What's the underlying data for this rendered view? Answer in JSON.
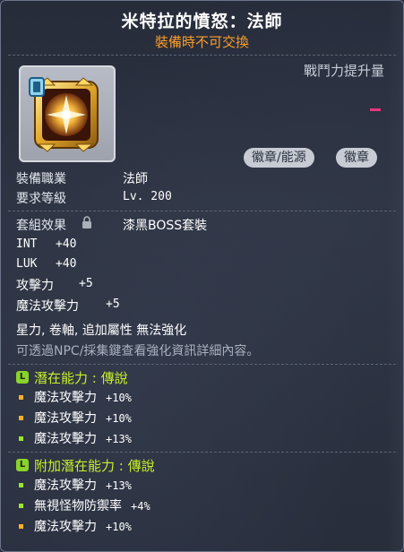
{
  "item": {
    "name": "米特拉的憤怒：法師",
    "trade_restriction": "裝備時不可交換",
    "power_label": "戰鬥力提升量",
    "power_color": "#e8357c",
    "icon": "mitra-emblem-icon"
  },
  "badges": [
    "徽章/能源",
    "徽章"
  ],
  "requirements": {
    "job_label": "裝備職業",
    "job_value": "法師",
    "level_label": "要求等級",
    "level_value": "Lv. 200"
  },
  "set": {
    "label": "套組效果",
    "value": "漆黑BOSS套裝"
  },
  "stats": [
    {
      "name": "INT",
      "value": "+40"
    },
    {
      "name": "LUK",
      "value": "+40"
    },
    {
      "name": "攻擊力",
      "value": "+5"
    },
    {
      "name": "魔法攻擊力",
      "value": "+5"
    }
  ],
  "flags": "星力, 卷軸, 追加屬性 無法強化",
  "hint": "可透過NPC/採集鍵查看強化資訊詳細內容。",
  "potential": {
    "title": "潛在能力 : 傳說",
    "grade_letter": "L",
    "lines": [
      {
        "name": "魔法攻擊力",
        "value": "+10%"
      },
      {
        "name": "魔法攻擊力",
        "value": "+10%"
      },
      {
        "name": "魔法攻擊力",
        "value": "+13%"
      }
    ]
  },
  "additional_potential": {
    "title": "附加潛在能力 : 傳說",
    "grade_letter": "L",
    "lines": [
      {
        "name": "魔法攻擊力",
        "value": "+13%"
      },
      {
        "name": "無視怪物防禦率",
        "value": "+4%"
      },
      {
        "name": "魔法攻擊力",
        "value": "+10%"
      }
    ]
  },
  "colors": {
    "title": "#ffffff",
    "trade": "#ff9d29",
    "legendary": "#c7f029",
    "bullet_orange": "#ffae2a",
    "bullet_green": "#9be52d"
  }
}
